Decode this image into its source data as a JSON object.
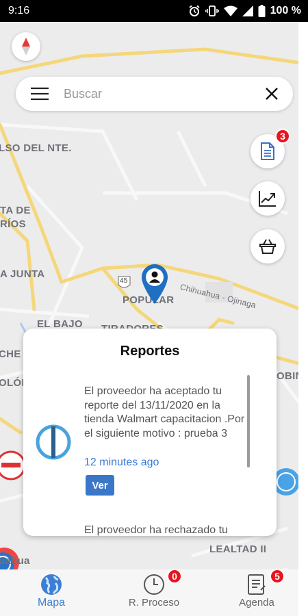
{
  "status_bar": {
    "time": "9:16",
    "battery": "100 %",
    "icons": [
      "alarm-icon",
      "vibrate-icon",
      "wifi-icon",
      "signal-icon",
      "battery-icon"
    ]
  },
  "map": {
    "labels": [
      "LSO DEL NTE.",
      "TA DE",
      "RÍOS",
      "A JUNTA",
      "POPULAR",
      "Chihuahua - Ojinaga",
      "EL BAJO",
      "TIRADORES",
      "CHE",
      "OLÓN",
      "OBIN",
      "LEALTAD II",
      "uahua",
      "45"
    ]
  },
  "search": {
    "placeholder": "Buscar"
  },
  "fabs": {
    "reports_badge": "3"
  },
  "reports_card": {
    "title": "Reportes",
    "items": [
      {
        "message": "El proveedor ha aceptado tu reporte del 13/11/2020 en la tienda Walmart capacitacion .Por el siguiente motivo : prueba 3",
        "time": "12 minutes ago",
        "button": "Ver"
      },
      {
        "message": "El proveedor ha rechazado tu"
      }
    ]
  },
  "bottom_nav": {
    "items": [
      {
        "label": "Mapa",
        "badge": ""
      },
      {
        "label": "R. Proceso",
        "badge": "0"
      },
      {
        "label": "Agenda",
        "badge": "5"
      }
    ]
  },
  "colors": {
    "accent": "#3b7fd4",
    "badge": "#e8141f",
    "button": "#3b77c9"
  }
}
